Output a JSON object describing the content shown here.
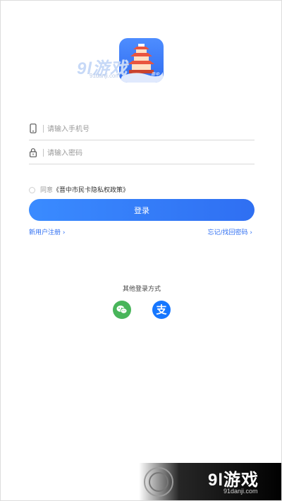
{
  "logo": {
    "tag": "晋中",
    "watermark_text": "9l游戏",
    "watermark_url": "91danji.com"
  },
  "form": {
    "phone_placeholder": "请输入手机号",
    "password_placeholder": "请输入密码"
  },
  "agreement": {
    "prefix": "同意",
    "policy": "《晋中市民卡隐私权政策》",
    "checked": false
  },
  "login_button": "登录",
  "links": {
    "register": "新用户注册 ›",
    "forgot": "忘记/找回密码 ›"
  },
  "other_login": {
    "title": "其他登录方式",
    "alipay_glyph": "支"
  },
  "bottom_watermark": {
    "brand": "9l游戏",
    "site": "91danji.com"
  },
  "colors": {
    "accent": "#2f6ff2",
    "wechat": "#48b55a",
    "alipay": "#1677ff"
  },
  "icons": {
    "phone": "phone-icon",
    "lock": "lock-icon",
    "wechat": "wechat-icon",
    "alipay": "alipay-icon"
  }
}
